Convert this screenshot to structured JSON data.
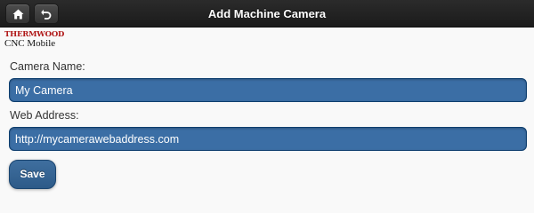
{
  "header": {
    "title": "Add Machine Camera",
    "home_icon": "home-icon",
    "back_icon": "back-arrow-icon"
  },
  "logo": {
    "top": "THERMWOOD",
    "bottom": "CNC Mobile"
  },
  "form": {
    "camera_name_label": "Camera Name:",
    "camera_name_value": "My Camera",
    "web_address_label": "Web Address:",
    "web_address_value": "http://mycamerawebaddress.com",
    "save_label": "Save"
  },
  "colors": {
    "header_bg": "#1f1f1f",
    "input_bg": "#3b6ea5",
    "button_bg": "#336699",
    "logo_red": "#b01818"
  }
}
